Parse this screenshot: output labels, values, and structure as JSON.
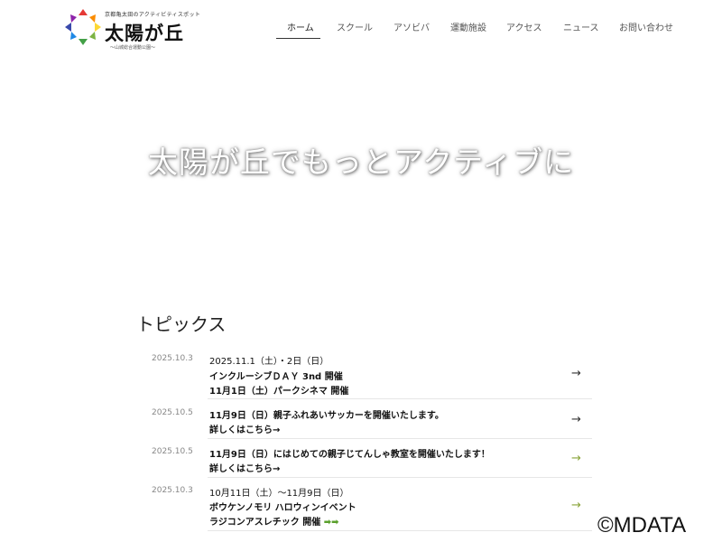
{
  "logo": {
    "tagline": "京都亀太田のアクティビティスポット",
    "name": "太陽が丘",
    "subtitle": "〜山城総合運動公園〜"
  },
  "nav": {
    "items": [
      {
        "label": "ホーム",
        "active": true
      },
      {
        "label": "スクール"
      },
      {
        "label": "アソビバ"
      },
      {
        "label": "運動施設"
      },
      {
        "label": "アクセス"
      },
      {
        "label": "ニュース"
      },
      {
        "label": "お問い合わせ"
      }
    ]
  },
  "hero": {
    "headline": "太陽が丘でもっとアクティブに"
  },
  "topics": {
    "title": "トピックス",
    "items": [
      {
        "date": "2025.10.3",
        "lines": [
          "2025.11.1（土）・2日（日）",
          "インクルーシブＤＡＹ 3nd 開催",
          "11月1日（土）パークシネマ 開催"
        ],
        "arrow": "→"
      },
      {
        "date": "2025.10.5",
        "lines": [
          "11月9日（日）親子ふれあいサッカーを開催いたします。",
          "詳しくはこちら→"
        ],
        "arrow": "→"
      },
      {
        "date": "2025.10.5",
        "lines": [
          "11月9日（日）にはじめての親子じてんしゃ教室を開催いたします！",
          "詳しくはこちら→"
        ],
        "arrow": "→"
      },
      {
        "date": "2025.10.3",
        "lines": [
          "10月11日（土）〜11月9日（日）",
          "ボウケンノモリ ハロウィンイベント",
          "ラジコンアスレチック 開催"
        ],
        "inline_arrows": "➡➡",
        "arrow": "→"
      }
    ]
  },
  "watermark": "©MDATA",
  "colors": {
    "nav_active_underline": "#333333",
    "topic_arrow_green": "#8aa43a",
    "hero_text": "#ffffff"
  }
}
